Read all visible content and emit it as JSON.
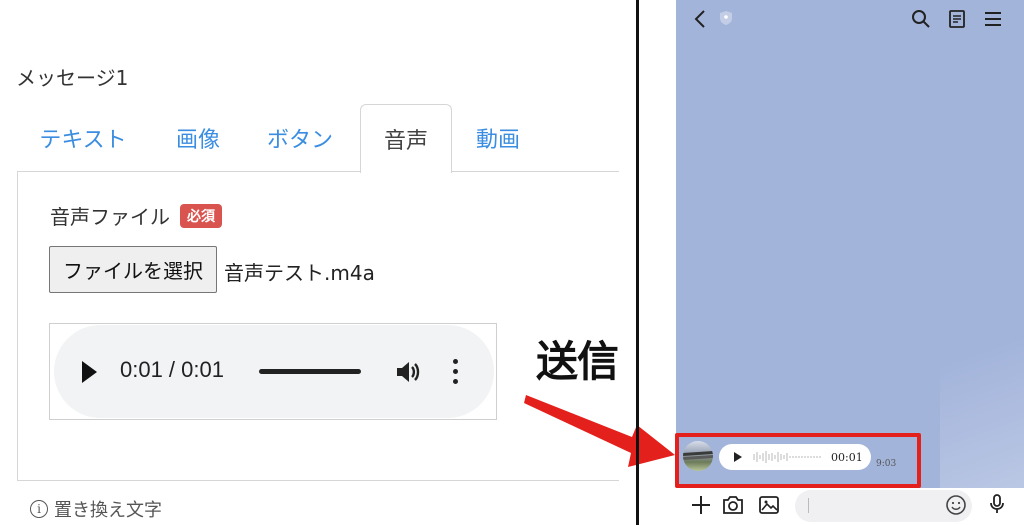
{
  "editor": {
    "message_heading": "メッセージ1",
    "tabs": [
      {
        "label": "テキスト",
        "active": false
      },
      {
        "label": "画像",
        "active": false
      },
      {
        "label": "ボタン",
        "active": false
      },
      {
        "label": "音声",
        "active": true
      },
      {
        "label": "動画",
        "active": false
      }
    ],
    "audio_file_label": "音声ファイル",
    "required_badge": "必須",
    "choose_file_button": "ファイルを選択",
    "selected_file_name": "音声テスト.m4a",
    "audio_player": {
      "time": "0:01 / 0:01",
      "progress": 1.0
    },
    "alt_text_label": "置き換え文字"
  },
  "annotation": {
    "send_label": "送信",
    "arrow_color": "#e4201c",
    "highlight_color": "#e4201c"
  },
  "chat": {
    "background_color": "#a3b4db",
    "header_icons": [
      "back-chevron-icon",
      "shield-badge-icon",
      "search-icon",
      "notes-icon",
      "menu-icon"
    ],
    "voice_message": {
      "duration": "00:01",
      "sent_time": "9:03"
    },
    "input_bar_icons": [
      "plus-icon",
      "camera-icon",
      "image-icon",
      "emoji-icon",
      "microphone-icon"
    ]
  },
  "colors": {
    "link_blue": "#3a8de0",
    "badge_red": "#d9534f"
  }
}
